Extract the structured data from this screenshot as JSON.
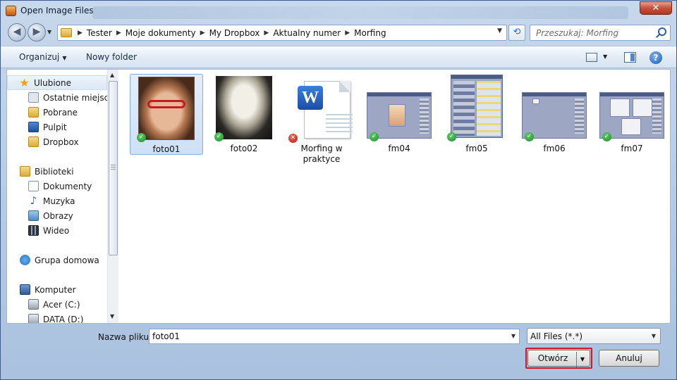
{
  "window": {
    "title": "Open Image Files",
    "close_label": "✕"
  },
  "address": {
    "crumbs": [
      "Tester",
      "Moje dokumenty",
      "My Dropbox",
      "Aktualny numer",
      "Morfing"
    ],
    "search_placeholder": "Przeszukaj: Morfing"
  },
  "toolbar": {
    "organize_label": "Organizuj",
    "new_folder_label": "Nowy folder",
    "help_label": "?"
  },
  "sidebar": {
    "items": [
      {
        "label": "Ulubione",
        "icon": "star-icon"
      },
      {
        "label": "Ostatnie miejsca",
        "icon": "recent-places-icon"
      },
      {
        "label": "Pobrane",
        "icon": "downloads-icon"
      },
      {
        "label": "Pulpit",
        "icon": "desktop-icon"
      },
      {
        "label": "Dropbox",
        "icon": "dropbox-icon"
      },
      {
        "label": "Biblioteki",
        "icon": "libraries-icon"
      },
      {
        "label": "Dokumenty",
        "icon": "documents-icon"
      },
      {
        "label": "Muzyka",
        "icon": "music-icon"
      },
      {
        "label": "Obrazy",
        "icon": "pictures-icon"
      },
      {
        "label": "Wideo",
        "icon": "video-icon"
      },
      {
        "label": "Grupa domowa",
        "icon": "homegroup-icon"
      },
      {
        "label": "Komputer",
        "icon": "computer-icon"
      },
      {
        "label": "Acer (C:)",
        "icon": "drive-icon"
      },
      {
        "label": "DATA (D:)",
        "icon": "drive-icon"
      }
    ]
  },
  "files": [
    {
      "name": "foto01",
      "status": "synced",
      "selected": true
    },
    {
      "name": "foto02",
      "status": "synced"
    },
    {
      "name": "Morfing w praktyce",
      "status": "error"
    },
    {
      "name": "fm04",
      "status": "synced"
    },
    {
      "name": "fm05",
      "status": "synced"
    },
    {
      "name": "fm06",
      "status": "synced"
    },
    {
      "name": "fm07",
      "status": "synced"
    }
  ],
  "footer": {
    "filename_label": "Nazwa pliku:",
    "filename_value": "foto01",
    "filter_value": "All Files (*.*)",
    "open_label": "Otwórz",
    "cancel_label": "Anuluj"
  },
  "colors": {
    "accent": "#d5162a",
    "selection": "#cfe0f5",
    "sync_ok": "#1d8a2b",
    "sync_error": "#b51e10"
  }
}
